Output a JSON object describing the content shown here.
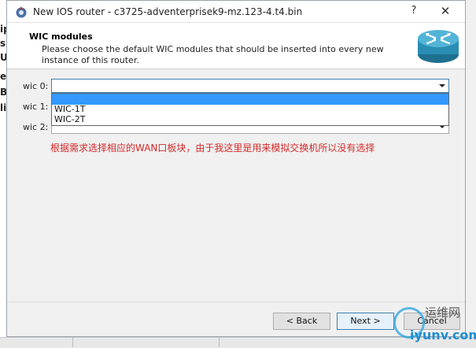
{
  "window": {
    "title": "New IOS router - c3725-adventerprisek9-mz.123-4.t4.bin",
    "help_glyph": "?",
    "close_glyph": "✕"
  },
  "header": {
    "title": "WIC modules",
    "description": "Please choose the default WIC modules that should be inserted into every new instance of this router."
  },
  "form": {
    "rows": [
      {
        "label": "wic 0:",
        "value": ""
      },
      {
        "label": "wic 1:",
        "value": ""
      },
      {
        "label": "wic 2:",
        "value": ""
      }
    ],
    "dropdown_options": [
      "",
      "WIC-1T",
      "WIC-2T"
    ],
    "note": "根据需求选择相应的WAN口板块，由于我这里是用来模拟交换机所以没有选择"
  },
  "buttons": {
    "back": "< Back",
    "next": "Next >",
    "cancel": "Cancel"
  },
  "background_app": {
    "letters": [
      "ip",
      "s",
      "U",
      "e",
      "B",
      "li"
    ]
  },
  "watermark": {
    "text": "运维网",
    "sub": "iyunv.com"
  },
  "colors": {
    "note": "#d42a2a",
    "selection": "#3399ff",
    "focus_border": "#3c7fb1"
  }
}
